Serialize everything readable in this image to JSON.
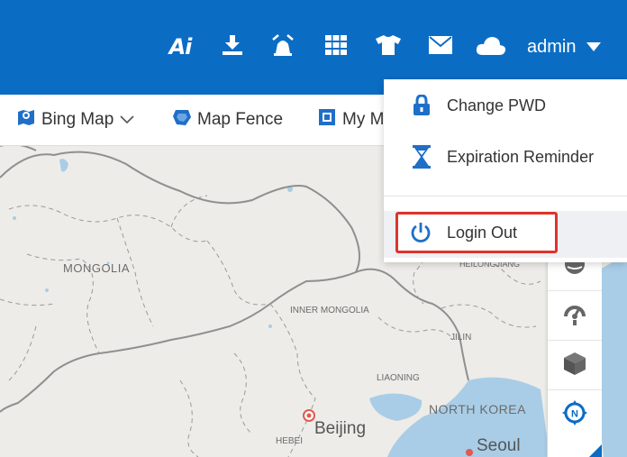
{
  "topbar": {
    "logo_text": "Ai",
    "icons": [
      "download-icon",
      "alarm-icon",
      "grid-icon",
      "shirt-icon",
      "mail-icon",
      "cloud-icon"
    ],
    "user_label": "admin",
    "bg_color": "#0b6cc4"
  },
  "toolbar": {
    "items": [
      {
        "label": "Bing Map",
        "icon": "map-marker-icon"
      },
      {
        "label": "Map Fence",
        "icon": "fence-icon"
      },
      {
        "label": "My M",
        "icon": "square-icon"
      }
    ]
  },
  "user_menu": {
    "items": [
      {
        "label": "Change PWD",
        "icon": "lock-icon"
      },
      {
        "label": "Expiration Reminder",
        "icon": "hourglass-icon"
      },
      {
        "label": "Login Out",
        "icon": "power-icon"
      }
    ],
    "highlight_color": "#e0322b"
  },
  "map": {
    "labels": {
      "mongolia": "MONGOLIA",
      "inner_mongolia": "INNER MONGOLIA",
      "jilin": "JILIN",
      "liaoning": "LIAONING",
      "north_korea": "NORTH KOREA",
      "beijing": "Beijing",
      "hebei": "HEBEI",
      "seoul": "Seoul",
      "heilongjiang": "HEILONGJIANG"
    }
  },
  "side_tools": [
    "globe-icon",
    "speedometer-icon",
    "cube-icon",
    "compass-icon"
  ]
}
